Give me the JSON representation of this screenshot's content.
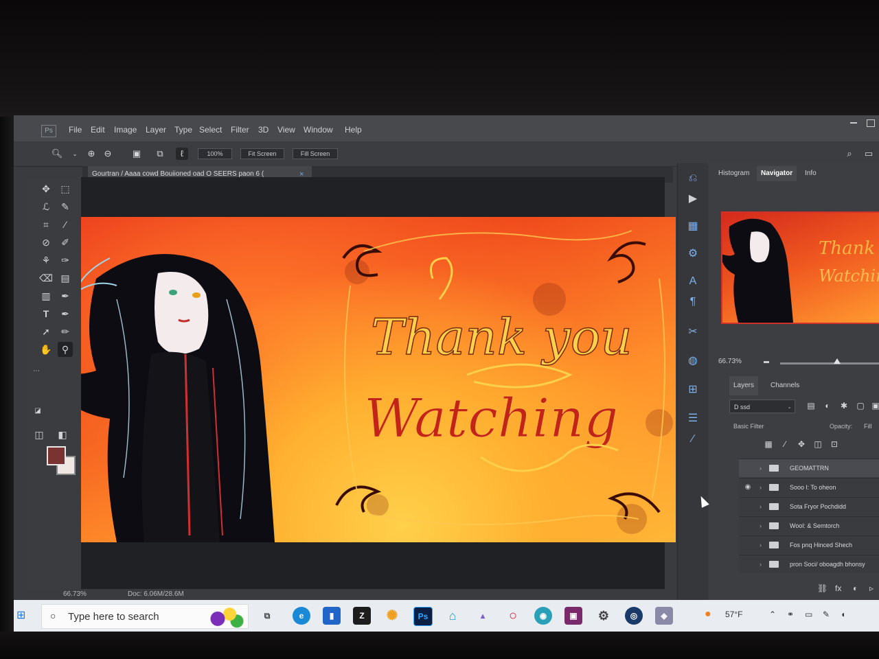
{
  "menu": {
    "items": [
      "File",
      "Edit",
      "Image",
      "Layer",
      "Type",
      "Select",
      "Filter",
      "3D",
      "View",
      "Window",
      "Help"
    ]
  },
  "options": {
    "field1": "100%",
    "field2": "Fit Screen",
    "field3": "Fill Screen"
  },
  "document_tab": {
    "label": "Gourtran / Aaaa cowd Bouiioned oad O SEERS paon 6 (",
    "close": "×"
  },
  "artwork": {
    "text_line1": "Thank you",
    "text_line2": "Watching",
    "accent": "#ff8f2a"
  },
  "status": {
    "zoom": "66.73%",
    "doc": "Doc: 6.06M/28.6M"
  },
  "panel": {
    "tabs": [
      "Histogram",
      "Navigator",
      "Info"
    ],
    "active_tab": "Navigator",
    "zoom_label": "66.73%",
    "sub_tabs": [
      "Layers",
      "Channels"
    ],
    "blend_mode": "D ssd",
    "opacity_label": "Opacity:",
    "fill_label": "Fill",
    "search_row": "Basic Filter",
    "layers": [
      "GEOMATTRN",
      "Sooo l: To oheon",
      "Sota Fryor Pochdidd",
      "Wool: & Semtorch",
      "Fos pnq Hinced Shech",
      "pron Soci/ oboagdh bhonsy"
    ]
  },
  "taskbar": {
    "search_placeholder": "Type here to search",
    "weather": "57°F",
    "photoshop_label": "Ps",
    "store_label": "Z",
    "windows_label": "⊞"
  }
}
